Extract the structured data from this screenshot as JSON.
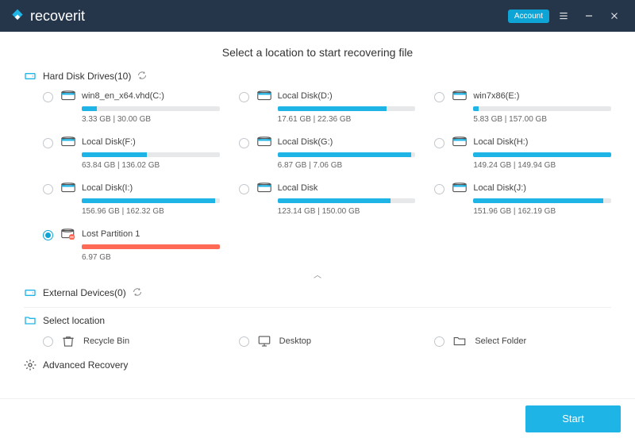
{
  "app": {
    "name": "recoverit",
    "account_label": "Account"
  },
  "page_title": "Select a location to start recovering file",
  "sections": {
    "hard_disks": {
      "label": "Hard Disk Drives(10)"
    },
    "external": {
      "label": "External Devices(0)"
    },
    "select_loc": {
      "label": "Select location"
    },
    "advanced": {
      "label": "Advanced Recovery"
    }
  },
  "drives": [
    {
      "name": "win8_en_x64.vhd(C:)",
      "used": 3.33,
      "total": 30.0,
      "size_text": "3.33  GB | 30.00  GB",
      "selected": false,
      "lost": false
    },
    {
      "name": "Local Disk(D:)",
      "used": 17.61,
      "total": 22.36,
      "size_text": "17.61  GB | 22.36  GB",
      "selected": false,
      "lost": false
    },
    {
      "name": "win7x86(E:)",
      "used": 5.83,
      "total": 157.0,
      "size_text": "5.83  GB | 157.00  GB",
      "selected": false,
      "lost": false
    },
    {
      "name": "Local Disk(F:)",
      "used": 63.84,
      "total": 136.02,
      "size_text": "63.84  GB | 136.02  GB",
      "selected": false,
      "lost": false
    },
    {
      "name": "Local Disk(G:)",
      "used": 6.87,
      "total": 7.06,
      "size_text": "6.87  GB | 7.06  GB",
      "selected": false,
      "lost": false
    },
    {
      "name": "Local Disk(H:)",
      "used": 149.24,
      "total": 149.94,
      "size_text": "149.24  GB | 149.94  GB",
      "selected": false,
      "lost": false
    },
    {
      "name": "Local Disk(I:)",
      "used": 156.96,
      "total": 162.32,
      "size_text": "156.96  GB | 162.32  GB",
      "selected": false,
      "lost": false
    },
    {
      "name": "Local Disk",
      "used": 123.14,
      "total": 150.0,
      "size_text": "123.14  GB | 150.00  GB",
      "selected": false,
      "lost": false
    },
    {
      "name": "Local Disk(J:)",
      "used": 151.96,
      "total": 162.19,
      "size_text": "151.96  GB | 162.19  GB",
      "selected": false,
      "lost": false
    },
    {
      "name": "Lost Partition 1",
      "used": 6.97,
      "total": 6.97,
      "size_text": "6.97  GB",
      "selected": true,
      "lost": true
    }
  ],
  "locations": [
    {
      "name": "Recycle Bin",
      "icon": "recycle-bin-icon"
    },
    {
      "name": "Desktop",
      "icon": "desktop-icon"
    },
    {
      "name": "Select Folder",
      "icon": "folder-icon"
    }
  ],
  "footer": {
    "start_label": "Start"
  },
  "colors": {
    "accent": "#1fb4e6",
    "header": "#25354a",
    "lost": "#ff6a57"
  }
}
